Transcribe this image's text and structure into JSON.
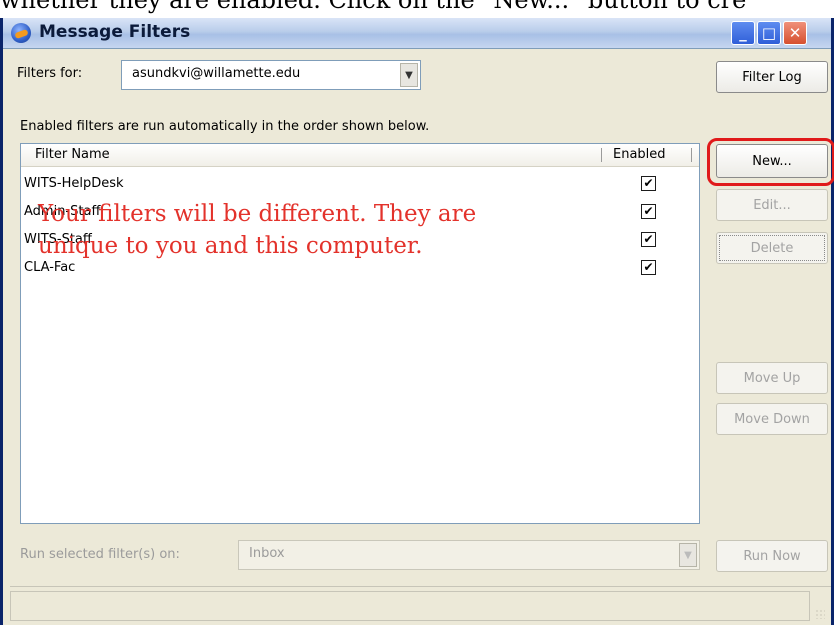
{
  "doc": {
    "top_text": "whether they are enabled. Click on the \"New...\" button to cre"
  },
  "window": {
    "title": "Message Filters",
    "controls": {
      "minimize": "_",
      "maximize": "□",
      "close": "✕"
    }
  },
  "filters_for": {
    "label": "Filters for:",
    "account": "asundkvi@willamette.edu"
  },
  "buttons": {
    "filter_log": "Filter Log",
    "new": "New...",
    "edit": "Edit...",
    "delete": "Delete",
    "move_up": "Move Up",
    "move_down": "Move Down",
    "run_now": "Run Now"
  },
  "info_text": "Enabled filters are run automatically in the order shown below.",
  "table": {
    "columns": [
      "Filter Name",
      "Enabled"
    ],
    "rows": [
      {
        "name": "WITS-HelpDesk",
        "enabled": "✔"
      },
      {
        "name": "Admin-Staff",
        "enabled": "✔"
      },
      {
        "name": "WITS-Staff",
        "enabled": "✔"
      },
      {
        "name": "CLA-Fac",
        "enabled": "✔"
      }
    ]
  },
  "annotation": {
    "line1": "Your filters will be different. They are",
    "line2": "unique to you and this computer."
  },
  "run_on": {
    "label": "Run selected filter(s) on:",
    "folder": "Inbox"
  },
  "colors": {
    "annotation_red": "#e3322b",
    "highlight_border": "#e01a1a",
    "window_face": "#ece9d8"
  }
}
